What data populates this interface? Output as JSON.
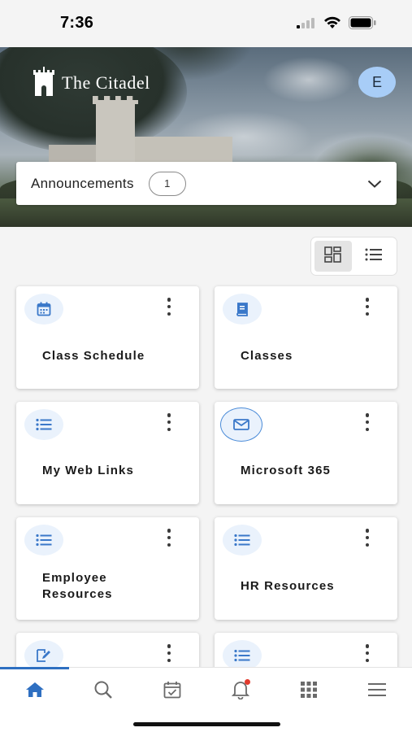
{
  "status_bar": {
    "time": "7:36"
  },
  "header": {
    "brand": "The Citadel",
    "avatar_initial": "E"
  },
  "announcements": {
    "label": "Announcements",
    "count": "1"
  },
  "view_toggle": {
    "selected": "grid"
  },
  "cards": [
    {
      "title": "Class Schedule",
      "icon": "calendar-icon"
    },
    {
      "title": "Classes",
      "icon": "book-icon"
    },
    {
      "title": "My Web Links",
      "icon": "list-icon"
    },
    {
      "title": "Microsoft 365",
      "icon": "mail-icon"
    },
    {
      "title": "Employee Resources",
      "icon": "list-icon"
    },
    {
      "title": "HR Resources",
      "icon": "list-icon"
    },
    {
      "title": "",
      "icon": "edit-document-icon"
    },
    {
      "title": "",
      "icon": "list-icon"
    }
  ],
  "bottom_nav": {
    "items": [
      "home-icon",
      "search-icon",
      "calendar-check-icon",
      "bell-icon",
      "apps-grid-icon",
      "menu-icon"
    ],
    "active": "home-icon"
  },
  "colors": {
    "accent": "#2e6fc1",
    "icon_blue": "#3a78c9",
    "avatar_bg": "#a8cdf7",
    "notification": "#e23b2e"
  }
}
